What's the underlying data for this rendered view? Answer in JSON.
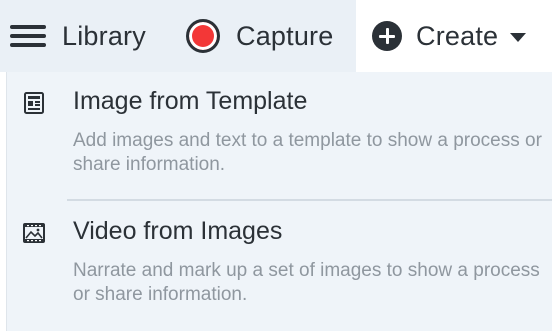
{
  "toolbar": {
    "library_label": "Library",
    "capture_label": "Capture",
    "create_label": "Create",
    "icons": {
      "library": "hamburger-icon",
      "capture": "record-icon",
      "create": "plus-circle-icon",
      "dropdown": "caret-down-icon"
    },
    "colors": {
      "record": "#f33737",
      "text": "#2b3137",
      "toolbar_bg": "#eaf0f6"
    }
  },
  "create_menu": {
    "items": [
      {
        "icon": "template-icon",
        "title": "Image from Template",
        "description": "Add images and text to a template to show a process or share information."
      },
      {
        "icon": "video-images-icon",
        "title": "Video from Images",
        "description": "Narrate and mark up a set of images to show a process or share information."
      }
    ],
    "colors": {
      "menu_bg": "#eff4f9",
      "description_text": "#8f979f"
    }
  }
}
